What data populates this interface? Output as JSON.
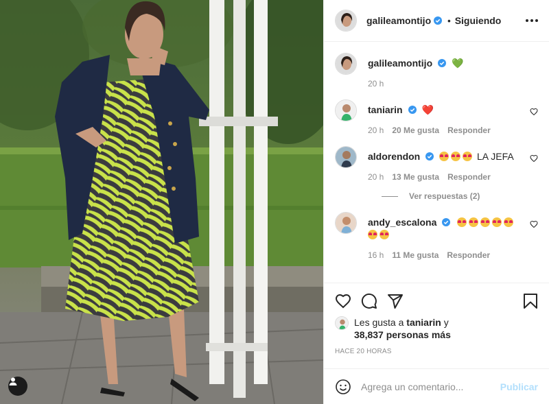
{
  "post": {
    "author": "galileamontijo",
    "follow_status": "Siguiendo",
    "dot": "•",
    "caption_emoji": "💚",
    "caption_time": "20 h"
  },
  "comments": [
    {
      "user": "taniarin",
      "text": "❤️",
      "time": "20 h",
      "likes": "20 Me gusta",
      "reply": "Responder"
    },
    {
      "user": "aldorendon",
      "text": "😍😍😍 LA JEFA",
      "time": "20 h",
      "likes": "13 Me gusta",
      "reply": "Responder",
      "emoji_count": 3,
      "text_after": "LA JEFA",
      "view_replies": "Ver respuestas (2)"
    },
    {
      "user": "andy_escalona",
      "text": "😍😍😍😍😍😍😍",
      "time": "16 h",
      "likes": "11 Me gusta",
      "reply": "Responder",
      "emoji_count": 7
    }
  ],
  "likes_summary": {
    "prefix": "Les gusta a",
    "user": "taniarin",
    "conj": "y",
    "count": "38,837 personas más"
  },
  "time_ago": "HACE 20 HORAS",
  "add_comment": {
    "placeholder": "Agrega un comentario...",
    "publish": "Publicar"
  },
  "icons": {
    "more": "more-horizontal-icon",
    "like": "heart-icon",
    "comment": "comment-icon",
    "share": "paper-plane-icon",
    "save": "bookmark-icon",
    "emoji": "smiley-icon",
    "tag": "user-tag-icon",
    "verified": "verified-badge-icon"
  },
  "colors": {
    "verified": "#3897f0",
    "publish_disabled": "#b2dffc",
    "muted": "#8e8e8e"
  }
}
